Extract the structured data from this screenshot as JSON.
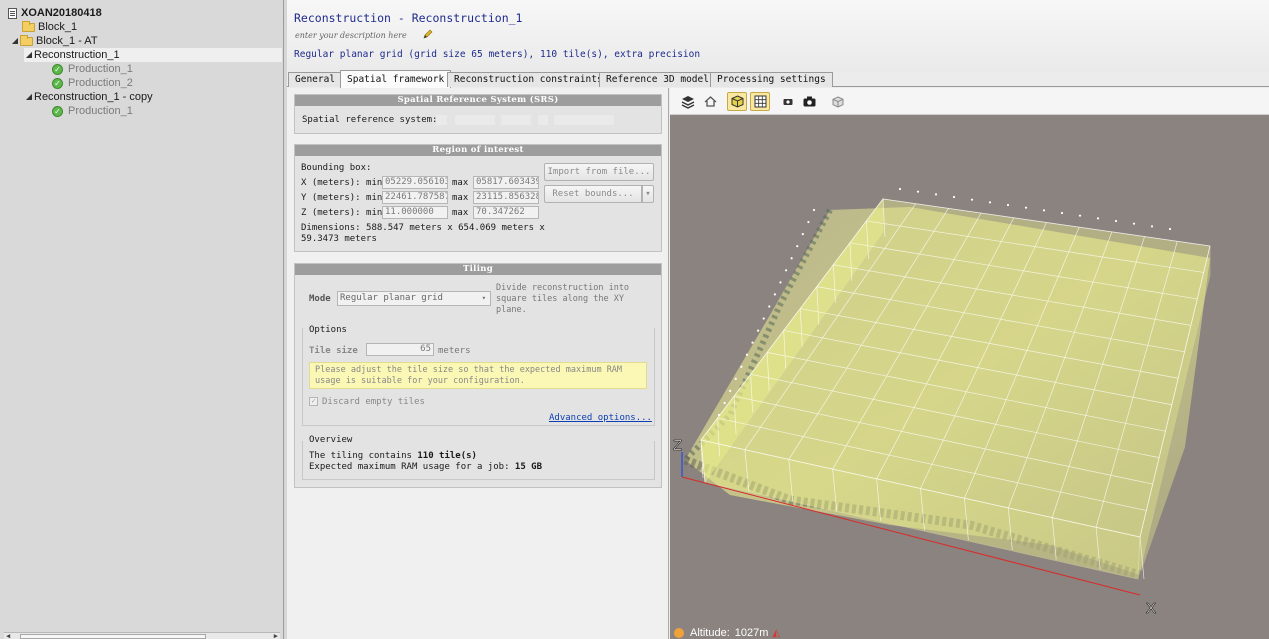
{
  "tree": {
    "root": "XOAN20180418",
    "block1": "Block_1",
    "block1_at": "Block_1 - AT",
    "reconstruction1": "Reconstruction_1",
    "production1": "Production_1",
    "production2": "Production_2",
    "reconstruction1_copy": "Reconstruction_1 - copy",
    "production1_copy": "Production_1"
  },
  "header": {
    "title": "Reconstruction - Reconstruction_1",
    "description_placeholder": "enter your description here",
    "subtitle": "Regular planar grid (grid size 65 meters), 110 tile(s), extra precision"
  },
  "tabs": [
    "General",
    "Spatial framework",
    "Reconstruction constraints",
    "Reference 3D model",
    "Processing settings"
  ],
  "srs": {
    "heading": "Spatial Reference System (SRS)",
    "label": "Spatial reference system:"
  },
  "roi": {
    "heading": "Region of interest",
    "bounding_box_label": "Bounding box:",
    "x_label": "X (meters): min",
    "y_label": "Y (meters): min",
    "z_label": "Z (meters): min",
    "max_label": "max",
    "x_min": "05229.056103",
    "x_max": "05817.603439",
    "y_min": "22461.787587",
    "y_max": "23115.856328",
    "z_min": "11.000000",
    "z_max": "70.347262",
    "dimensions_line1": "Dimensions: 588.547 meters x 654.069 meters x",
    "dimensions_line2": "59.3473 meters",
    "import_button": "Import from file...",
    "reset_button": "Reset bounds...",
    "reset_dropdown_arrow": "▾"
  },
  "tiling": {
    "heading": "Tiling",
    "mode_label": "Mode",
    "mode_value": "Regular planar grid",
    "mode_help_line1": "Divide reconstruction into",
    "mode_help_line2": "square tiles along the XY",
    "mode_help_line3": "plane.",
    "options_label": "Options",
    "tile_size_label": "Tile size",
    "tile_size_value": "65",
    "tile_size_unit": "meters",
    "warning_line1": "Please adjust the tile size so that the expected maximum RAM",
    "warning_line2": "usage is suitable for your configuration.",
    "discard_label": "Discard empty tiles",
    "discard_checked": true,
    "advanced_link": "Advanced options...",
    "overview_label": "Overview",
    "overview_line1_prefix": "The tiling contains ",
    "overview_line1_bold": "110 tile(s)",
    "overview_line2_prefix": "Expected maximum RAM usage for a job: ",
    "overview_line2_bold": "15 GB"
  },
  "viewer": {
    "toolbar_icons": [
      "layers-icon",
      "home-icon",
      "cube-view-icon",
      "grid-view-icon",
      "small-camera-icon",
      "camera-icon",
      "cube-outline-icon"
    ],
    "axis_z": "Z",
    "axis_x": "X",
    "altitude_label": "Altitude:",
    "altitude_value": "1027m"
  },
  "colors": {
    "title_blue": "#1f2b8c",
    "link_blue": "#0b3fb3",
    "tile_yellow": "#eef28c",
    "success_green": "#5cb84a",
    "viewport_bg": "#8b837f"
  }
}
